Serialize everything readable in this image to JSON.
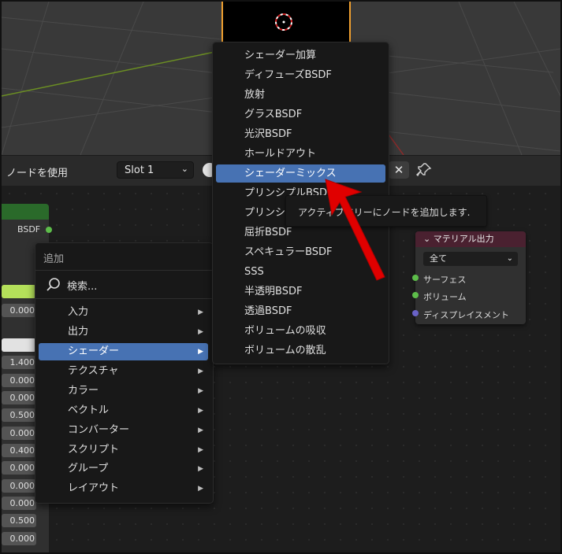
{
  "header": {
    "use_nodes_label": "ノードを使用",
    "slot_label": "Slot 1",
    "close_symbol": "✕"
  },
  "left_node": {
    "output_label": "BSDF",
    "values": [
      "0.000",
      "1.400",
      "0.000",
      "0.000",
      "0.500",
      "0.000",
      "0.400",
      "0.000",
      "0.000",
      "0.000",
      "0.500",
      "0.000"
    ]
  },
  "material_output": {
    "title": "マテリアル出力",
    "target": "全て",
    "sockets": [
      "サーフェス",
      "ボリューム",
      "ディスプレイスメント"
    ],
    "socket_colors": [
      "#5dbd4a",
      "#5dbd4a",
      "#6a63c7"
    ]
  },
  "tooltip": {
    "text": "アクティブツリーにノードを追加します."
  },
  "add_menu": {
    "title": "追加",
    "search_label": "検索...",
    "items": [
      "入力",
      "出力",
      "シェーダー",
      "テクスチャ",
      "カラー",
      "ベクトル",
      "コンバーター",
      "スクリプト",
      "グループ",
      "レイアウト"
    ],
    "active_item": "シェーダー"
  },
  "shader_menu": {
    "items": [
      "シェーダー加算",
      "ディフューズBSDF",
      "放射",
      "グラスBSDF",
      "光沢BSDF",
      "ホールドアウト",
      "シェーダーミックス",
      "プリンシプルBSDF",
      "プリンシ",
      "屈折BSDF",
      "スペキュラーBSDF",
      "SSS",
      "半透明BSDF",
      "透過BSDF",
      "ボリュームの吸収",
      "ボリュームの散乱"
    ],
    "active_item": "シェーダーミックス"
  },
  "colors": {
    "accent": "#4772b3",
    "annotation_arrow": "#e00000",
    "object_outline": "#f0a030",
    "axis_x": "#8b2b2b",
    "axis_y": "#6b8e23"
  }
}
